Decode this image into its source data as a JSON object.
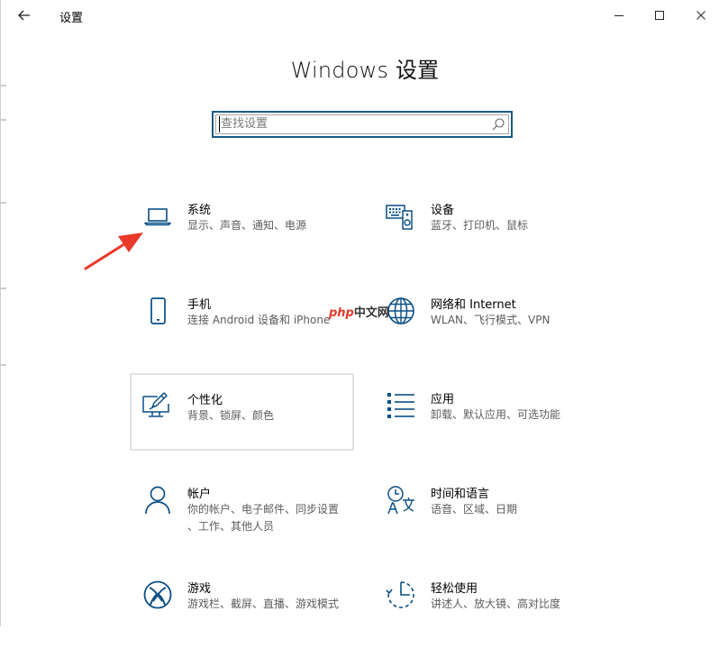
{
  "window": {
    "title": "设置",
    "back_icon": "arrow-left-icon",
    "minimize_icon": "minimize-icon",
    "maximize_icon": "maximize-icon",
    "close_icon": "close-icon"
  },
  "header": {
    "title": "Windows 设置"
  },
  "search": {
    "placeholder": "查找设置",
    "value": "",
    "icon": "search-icon"
  },
  "tiles": [
    {
      "name": "系统",
      "desc": "显示、声音、通知、电源",
      "icon": "laptop-icon"
    },
    {
      "name": "设备",
      "desc": "蓝牙、打印机、鼠标",
      "icon": "devices-icon"
    },
    {
      "name": "手机",
      "desc": "连接 Android 设备和 iPhone",
      "icon": "phone-icon"
    },
    {
      "name": "网络和 Internet",
      "desc": "WLAN、飞行模式、VPN",
      "icon": "globe-icon"
    },
    {
      "name": "个性化",
      "desc": "背景、锁屏、颜色",
      "icon": "personalization-icon"
    },
    {
      "name": "应用",
      "desc": "卸载、默认应用、可选功能",
      "icon": "apps-list-icon"
    },
    {
      "name": "帐户",
      "desc": "你的帐户、电子邮件、同步设置、工作、其他人员",
      "desc_line1": "你的帐户、电子邮件、同步设置",
      "desc_line2": "、工作、其他人员",
      "icon": "person-icon"
    },
    {
      "name": "时间和语言",
      "desc": "语音、区域、日期",
      "icon": "time-language-icon"
    },
    {
      "name": "游戏",
      "desc": "游戏栏、截屏、直播、游戏模式",
      "icon": "xbox-icon"
    },
    {
      "name": "轻松使用",
      "desc": "讲述人、放大镜、高对比度",
      "icon": "ease-of-access-icon"
    }
  ],
  "annotation": {
    "icon": "red-arrow-icon",
    "color": "#e8392b"
  },
  "watermark": {
    "part1": "php",
    "part2": "中文网"
  },
  "colors": {
    "accent": "#1a5a85",
    "icon": "#0a4f86",
    "text_secondary": "#5c5c5c"
  }
}
